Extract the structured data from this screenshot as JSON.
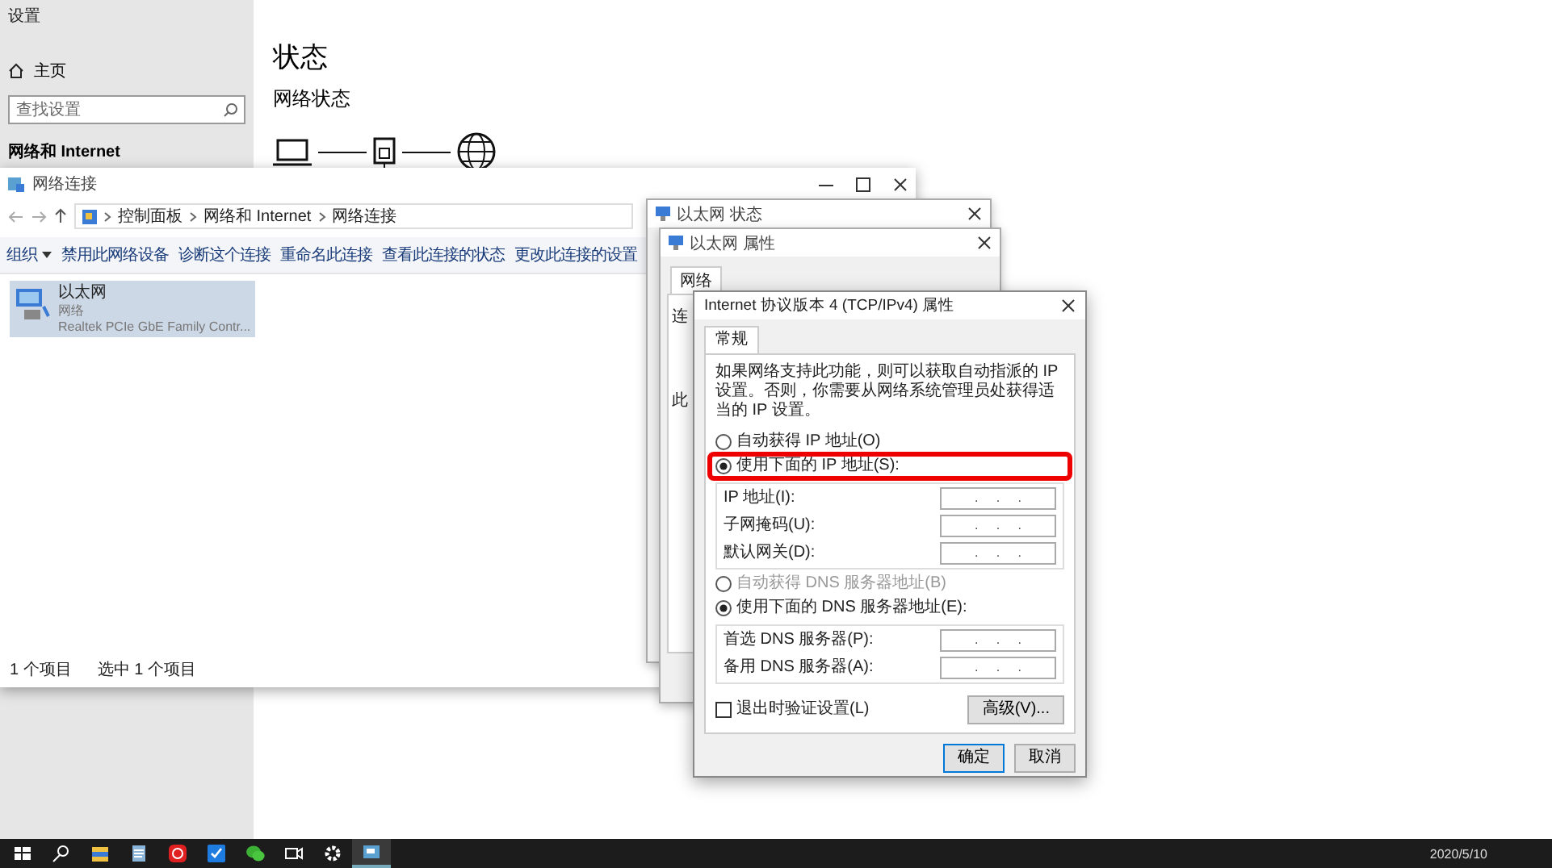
{
  "settings": {
    "app_title": "设置",
    "home": "主页",
    "search": {
      "placeholder": "查找设置"
    },
    "section": "网络和 Internet",
    "heading": "状态",
    "subheading": "网络状态"
  },
  "network_window": {
    "title": "网络连接",
    "breadcrumb": [
      "控制面板",
      "网络和 Internet",
      "网络连接"
    ],
    "toolbar": [
      {
        "label": "组织",
        "has_menu": true
      },
      {
        "label": "禁用此网络设备",
        "has_menu": false
      },
      {
        "label": "诊断这个连接",
        "has_menu": false
      },
      {
        "label": "重命名此连接",
        "has_menu": false
      },
      {
        "label": "查看此连接的状态",
        "has_menu": false
      },
      {
        "label": "更改此连接的设置",
        "has_menu": false
      }
    ],
    "items": [
      {
        "name": "以太网",
        "status": "网络",
        "device": "Realtek PCIe GbE Family Contr...",
        "selected": true
      }
    ],
    "status_bar": [
      "1 个项目",
      "选中 1 个项目"
    ]
  },
  "back_dialogs": [
    {
      "title": "以太网 状态"
    },
    {
      "title": "以太网 属性",
      "tab": "网络",
      "fragments": [
        "连",
        "此"
      ]
    }
  ],
  "ipv4_dialog": {
    "title": "Internet 协议版本 4 (TCP/IPv4) 属性",
    "tabs": [
      {
        "label": "常规",
        "selected": true
      }
    ],
    "intro": "如果网络支持此功能，则可以获取自动指派的 IP 设置。否则，你需要从网络系统管理员处获得适当的 IP 设置。",
    "ip_mode": [
      {
        "label": "自动获得 IP 地址(O)",
        "selected": false
      },
      {
        "label": "使用下面的 IP 地址(S):",
        "selected": true,
        "highlighted": true
      }
    ],
    "ip_fields": [
      {
        "label": "IP 地址(I):",
        "value": ".     .     ."
      },
      {
        "label": "子网掩码(U):",
        "value": ".     .     ."
      },
      {
        "label": "默认网关(D):",
        "value": ".     .     ."
      }
    ],
    "dns_mode": [
      {
        "label": "自动获得 DNS 服务器地址(B)",
        "selected": false,
        "disabled": true
      },
      {
        "label": "使用下面的 DNS 服务器地址(E):",
        "selected": true,
        "disabled": false
      }
    ],
    "dns_fields": [
      {
        "label": "首选 DNS 服务器(P):",
        "value": ".     .     ."
      },
      {
        "label": "备用 DNS 服务器(A):",
        "value": ".     .     ."
      }
    ],
    "validate": {
      "label": "退出时验证设置(L)",
      "checked": false
    },
    "advanced": "高级(V)...",
    "buttons": [
      {
        "label": "确定",
        "default": true
      },
      {
        "label": "取消",
        "default": false
      }
    ]
  },
  "taskbar": {
    "apps": [
      {
        "kind": "start",
        "active": false
      },
      {
        "kind": "search",
        "active": false
      },
      {
        "kind": "folder",
        "active": false
      },
      {
        "kind": "notepad",
        "active": false
      },
      {
        "kind": "music",
        "active": false
      },
      {
        "kind": "mail",
        "active": false
      },
      {
        "kind": "chat",
        "active": false
      },
      {
        "kind": "camera",
        "active": false
      },
      {
        "kind": "settings",
        "active": false
      },
      {
        "kind": "network",
        "active": true
      }
    ],
    "date": "2020/5/10"
  }
}
